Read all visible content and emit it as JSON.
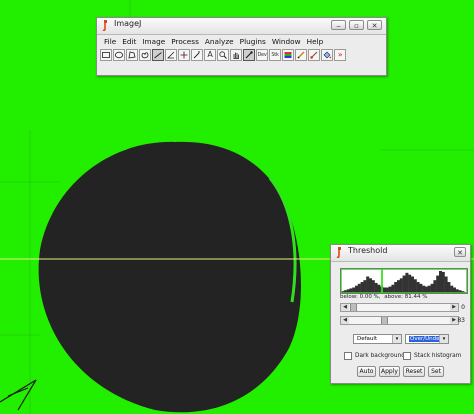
{
  "imagej": {
    "title": "ImageJ",
    "menus": [
      "File",
      "Edit",
      "Image",
      "Process",
      "Analyze",
      "Plugins",
      "Window",
      "Help"
    ],
    "tools": [
      {
        "name": "rectangle-tool-icon"
      },
      {
        "name": "oval-tool-icon"
      },
      {
        "name": "polygon-tool-icon"
      },
      {
        "name": "freehand-tool-icon"
      },
      {
        "name": "straight-line-tool-icon",
        "active": true
      },
      {
        "name": "angle-tool-icon"
      },
      {
        "name": "point-tool-icon"
      },
      {
        "name": "wand-tool-icon"
      },
      {
        "name": "text-tool-icon",
        "label": "A"
      },
      {
        "name": "magnifier-tool-icon"
      },
      {
        "name": "hand-tool-icon"
      },
      {
        "name": "color-picker-tool-icon"
      },
      {
        "name": "developer-menu-icon",
        "label": "Dev"
      },
      {
        "name": "stack-tools-icon",
        "label": "Stk"
      },
      {
        "name": "lut-menu-icon"
      },
      {
        "name": "pencil-tool-icon"
      },
      {
        "name": "brush-tool-icon"
      },
      {
        "name": "flood-fill-tool-icon"
      },
      {
        "name": "more-tools-icon",
        "label": "»"
      }
    ]
  },
  "threshold": {
    "title": "Threshold",
    "below_text": "below: 0.00 %,",
    "above_text": "above: 81.44 %",
    "min_value": "0",
    "max_value": "83",
    "method": "Default",
    "display_mode": "Over/Under",
    "dark_background_label": "Dark background",
    "stack_histogram_label": "Stack histogram",
    "buttons": {
      "auto": "Auto",
      "apply": "Apply",
      "reset": "Reset",
      "set": "Set"
    },
    "threshold_range": [
      0,
      83
    ],
    "histogram_bins": [
      2,
      3,
      4,
      5,
      6,
      8,
      10,
      12,
      14,
      18,
      16,
      14,
      11,
      9,
      7,
      6,
      6,
      7,
      9,
      12,
      14,
      16,
      19,
      22,
      20,
      18,
      15,
      12,
      10,
      8,
      7,
      8,
      10,
      14,
      19,
      24,
      23,
      18,
      12,
      8,
      6,
      4,
      3,
      2,
      1
    ]
  },
  "colors": {
    "background": "#22ee00",
    "object": "#222222",
    "overlay_line": "#e8f07a",
    "threshold_highlight": "#2fe31a",
    "histogram_fill": "#333333"
  }
}
